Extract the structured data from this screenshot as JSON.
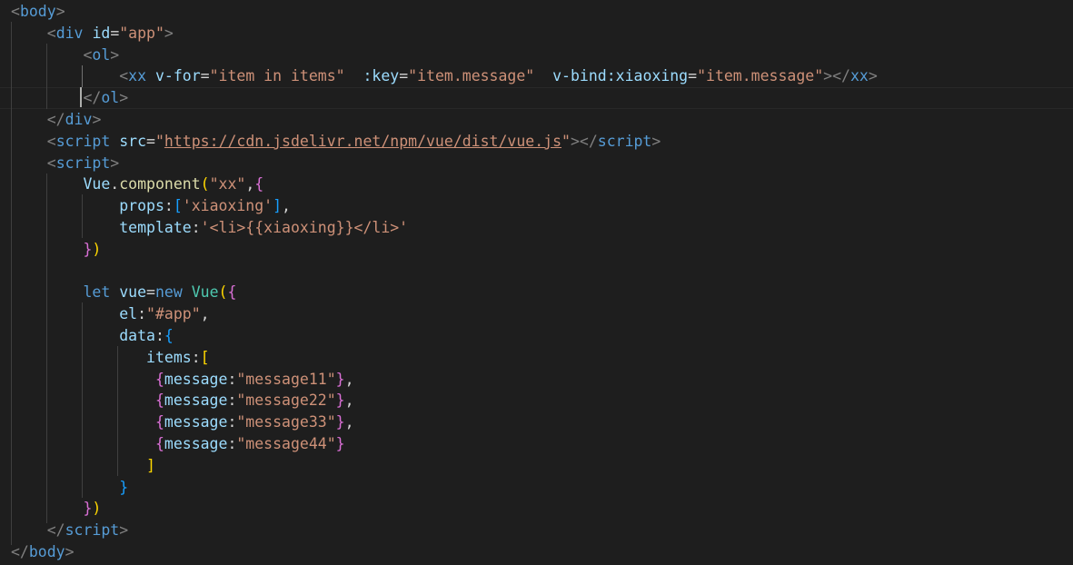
{
  "editor": {
    "lines": [
      [
        {
          "t": "<",
          "c": "tag-bracket"
        },
        {
          "t": "body",
          "c": "tag"
        },
        {
          "t": ">",
          "c": "tag-bracket"
        }
      ],
      [
        {
          "t": "    "
        },
        {
          "t": "<",
          "c": "tag-bracket"
        },
        {
          "t": "div",
          "c": "tag"
        },
        {
          "t": " "
        },
        {
          "t": "id",
          "c": "attr"
        },
        {
          "t": "=",
          "c": "punc"
        },
        {
          "t": "\"app\"",
          "c": "str"
        },
        {
          "t": ">",
          "c": "tag-bracket"
        }
      ],
      [
        {
          "t": "        "
        },
        {
          "t": "<",
          "c": "tag-bracket"
        },
        {
          "t": "ol",
          "c": "tag"
        },
        {
          "t": ">",
          "c": "tag-bracket"
        }
      ],
      [
        {
          "t": "            "
        },
        {
          "t": "<",
          "c": "tag-bracket"
        },
        {
          "t": "xx",
          "c": "tag"
        },
        {
          "t": " "
        },
        {
          "t": "v-for",
          "c": "attr"
        },
        {
          "t": "=",
          "c": "punc"
        },
        {
          "t": "\"item in items\"",
          "c": "str"
        },
        {
          "t": "  "
        },
        {
          "t": ":key",
          "c": "attr"
        },
        {
          "t": "=",
          "c": "punc"
        },
        {
          "t": "\"item.message\"",
          "c": "str"
        },
        {
          "t": "  "
        },
        {
          "t": "v-bind:xiaoxing",
          "c": "attr"
        },
        {
          "t": "=",
          "c": "punc"
        },
        {
          "t": "\"item.message\"",
          "c": "str"
        },
        {
          "t": "></",
          "c": "tag-bracket"
        },
        {
          "t": "xx",
          "c": "tag"
        },
        {
          "t": ">",
          "c": "tag-bracket"
        }
      ],
      [
        {
          "t": "        "
        },
        {
          "t": "</",
          "c": "tag-bracket"
        },
        {
          "t": "ol",
          "c": "tag"
        },
        {
          "t": ">",
          "c": "tag-bracket"
        }
      ],
      [
        {
          "t": "    "
        },
        {
          "t": "</",
          "c": "tag-bracket"
        },
        {
          "t": "div",
          "c": "tag"
        },
        {
          "t": ">",
          "c": "tag-bracket"
        }
      ],
      [
        {
          "t": "    "
        },
        {
          "t": "<",
          "c": "tag-bracket"
        },
        {
          "t": "script",
          "c": "tag"
        },
        {
          "t": " "
        },
        {
          "t": "src",
          "c": "attr"
        },
        {
          "t": "=",
          "c": "punc"
        },
        {
          "t": "\"",
          "c": "str"
        },
        {
          "t": "https://cdn.jsdelivr.net/npm/vue/dist/vue.js",
          "c": "url"
        },
        {
          "t": "\"",
          "c": "str"
        },
        {
          "t": "></",
          "c": "tag-bracket"
        },
        {
          "t": "script",
          "c": "tag"
        },
        {
          "t": ">",
          "c": "tag-bracket"
        }
      ],
      [
        {
          "t": "    "
        },
        {
          "t": "<",
          "c": "tag-bracket"
        },
        {
          "t": "script",
          "c": "tag"
        },
        {
          "t": ">",
          "c": "tag-bracket"
        }
      ],
      [
        {
          "t": "        "
        },
        {
          "t": "Vue",
          "c": "prop"
        },
        {
          "t": ".",
          "c": "punc"
        },
        {
          "t": "component",
          "c": "fn"
        },
        {
          "t": "(",
          "c": "b1"
        },
        {
          "t": "\"xx\"",
          "c": "str"
        },
        {
          "t": ",",
          "c": "punc"
        },
        {
          "t": "{",
          "c": "b2"
        }
      ],
      [
        {
          "t": "            "
        },
        {
          "t": "props",
          "c": "prop"
        },
        {
          "t": ":",
          "c": "punc"
        },
        {
          "t": "[",
          "c": "b3"
        },
        {
          "t": "'xiaoxing'",
          "c": "str"
        },
        {
          "t": "]",
          "c": "b3"
        },
        {
          "t": ",",
          "c": "punc"
        }
      ],
      [
        {
          "t": "            "
        },
        {
          "t": "template",
          "c": "prop"
        },
        {
          "t": ":",
          "c": "punc"
        },
        {
          "t": "'<li>{{xiaoxing}}</li>'",
          "c": "str"
        }
      ],
      [
        {
          "t": "        "
        },
        {
          "t": "}",
          "c": "b2"
        },
        {
          "t": ")",
          "c": "b1"
        }
      ],
      [
        {
          "t": ""
        }
      ],
      [
        {
          "t": "        "
        },
        {
          "t": "let",
          "c": "kw"
        },
        {
          "t": " "
        },
        {
          "t": "vue",
          "c": "prop"
        },
        {
          "t": "=",
          "c": "punc"
        },
        {
          "t": "new",
          "c": "kw"
        },
        {
          "t": " "
        },
        {
          "t": "Vue",
          "c": "cls"
        },
        {
          "t": "(",
          "c": "b1"
        },
        {
          "t": "{",
          "c": "b2"
        }
      ],
      [
        {
          "t": "            "
        },
        {
          "t": "el",
          "c": "prop"
        },
        {
          "t": ":",
          "c": "punc"
        },
        {
          "t": "\"#app\"",
          "c": "str"
        },
        {
          "t": ",",
          "c": "punc"
        }
      ],
      [
        {
          "t": "            "
        },
        {
          "t": "data",
          "c": "prop"
        },
        {
          "t": ":",
          "c": "punc"
        },
        {
          "t": "{",
          "c": "b3"
        }
      ],
      [
        {
          "t": "               "
        },
        {
          "t": "items",
          "c": "prop"
        },
        {
          "t": ":",
          "c": "punc"
        },
        {
          "t": "[",
          "c": "b1"
        }
      ],
      [
        {
          "t": "                "
        },
        {
          "t": "{",
          "c": "b2"
        },
        {
          "t": "message",
          "c": "prop"
        },
        {
          "t": ":",
          "c": "punc"
        },
        {
          "t": "\"message11\"",
          "c": "str"
        },
        {
          "t": "}",
          "c": "b2"
        },
        {
          "t": ",",
          "c": "punc"
        }
      ],
      [
        {
          "t": "                "
        },
        {
          "t": "{",
          "c": "b2"
        },
        {
          "t": "message",
          "c": "prop"
        },
        {
          "t": ":",
          "c": "punc"
        },
        {
          "t": "\"message22\"",
          "c": "str"
        },
        {
          "t": "}",
          "c": "b2"
        },
        {
          "t": ",",
          "c": "punc"
        }
      ],
      [
        {
          "t": "                "
        },
        {
          "t": "{",
          "c": "b2"
        },
        {
          "t": "message",
          "c": "prop"
        },
        {
          "t": ":",
          "c": "punc"
        },
        {
          "t": "\"message33\"",
          "c": "str"
        },
        {
          "t": "}",
          "c": "b2"
        },
        {
          "t": ",",
          "c": "punc"
        }
      ],
      [
        {
          "t": "                "
        },
        {
          "t": "{",
          "c": "b2"
        },
        {
          "t": "message",
          "c": "prop"
        },
        {
          "t": ":",
          "c": "punc"
        },
        {
          "t": "\"message44\"",
          "c": "str"
        },
        {
          "t": "}",
          "c": "b2"
        }
      ],
      [
        {
          "t": "               "
        },
        {
          "t": "]",
          "c": "b1"
        }
      ],
      [
        {
          "t": "            "
        },
        {
          "t": "}",
          "c": "b3"
        }
      ],
      [
        {
          "t": "        "
        },
        {
          "t": "}",
          "c": "b2"
        },
        {
          "t": ")",
          "c": "b1"
        }
      ],
      [
        {
          "t": "    "
        },
        {
          "t": "</",
          "c": "tag-bracket"
        },
        {
          "t": "script",
          "c": "tag"
        },
        {
          "t": ">",
          "c": "tag-bracket"
        }
      ],
      [
        {
          "t": "</",
          "c": "tag-bracket"
        },
        {
          "t": "body",
          "c": "tag"
        },
        {
          "t": ">",
          "c": "tag-bracket"
        }
      ]
    ],
    "current_line": 4
  }
}
